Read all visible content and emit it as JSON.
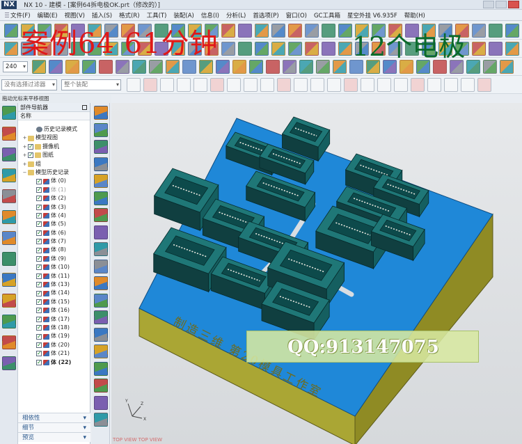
{
  "window": {
    "app_logo": "NX",
    "title": "NX 10 - 建模 - [案例64拆电极OK.prt（修改的）]"
  },
  "menu": {
    "items": [
      "文件(F)",
      "编辑(E)",
      "视图(V)",
      "插入(S)",
      "格式(R)",
      "工具(T)",
      "装配(A)",
      "信息(I)",
      "分析(L)",
      "首选项(P)",
      "窗口(O)",
      "GC工具箱",
      "星空外挂 V6.935F",
      "帮助(H)"
    ]
  },
  "toolbar": {
    "layer_value": "240",
    "filter_placeholder": "没有选择过滤器",
    "assembly_scope": "整个装配"
  },
  "overlays": {
    "red_caption": "案例64   61分钟",
    "green_caption": "12个电极",
    "qq_banner": "QQ:913147075"
  },
  "panel": {
    "drag_hint": "拖动光标来平移视图",
    "title": "部件导航器",
    "column_name": "名称",
    "nodes": [
      {
        "label": "历史记录模式",
        "level": 1,
        "check": false,
        "exp": ""
      },
      {
        "label": "模型视图",
        "level": 0,
        "check": false,
        "exp": "+"
      },
      {
        "label": "摄像机",
        "level": 0,
        "check": true,
        "exp": "+"
      },
      {
        "label": "图纸",
        "level": 0,
        "check": true,
        "exp": "+"
      },
      {
        "label": "组",
        "level": 0,
        "check": false,
        "exp": "+"
      },
      {
        "label": "模型历史记录",
        "level": 0,
        "check": false,
        "exp": "−"
      },
      {
        "label": "体 (0)",
        "level": 1,
        "check": true,
        "exp": ""
      },
      {
        "label": "体 (1)",
        "level": 1,
        "check": true,
        "exp": "",
        "dim": true
      },
      {
        "label": "体 (2)",
        "level": 1,
        "check": true,
        "exp": ""
      },
      {
        "label": "体 (3)",
        "level": 1,
        "check": true,
        "exp": ""
      },
      {
        "label": "体 (4)",
        "level": 1,
        "check": true,
        "exp": ""
      },
      {
        "label": "体 (5)",
        "level": 1,
        "check": true,
        "exp": ""
      },
      {
        "label": "体 (6)",
        "level": 1,
        "check": true,
        "exp": ""
      },
      {
        "label": "体 (7)",
        "level": 1,
        "check": true,
        "exp": ""
      },
      {
        "label": "体 (8)",
        "level": 1,
        "check": true,
        "exp": ""
      },
      {
        "label": "体 (9)",
        "level": 1,
        "check": true,
        "exp": ""
      },
      {
        "label": "体 (10)",
        "level": 1,
        "check": true,
        "exp": ""
      },
      {
        "label": "体 (11)",
        "level": 1,
        "check": true,
        "exp": ""
      },
      {
        "label": "体 (13)",
        "level": 1,
        "check": true,
        "exp": ""
      },
      {
        "label": "体 (14)",
        "level": 1,
        "check": true,
        "exp": ""
      },
      {
        "label": "体 (15)",
        "level": 1,
        "check": true,
        "exp": ""
      },
      {
        "label": "体 (16)",
        "level": 1,
        "check": true,
        "exp": ""
      },
      {
        "label": "体 (17)",
        "level": 1,
        "check": true,
        "exp": ""
      },
      {
        "label": "体 (18)",
        "level": 1,
        "check": true,
        "exp": ""
      },
      {
        "label": "体 (19)",
        "level": 1,
        "check": true,
        "exp": ""
      },
      {
        "label": "体 (20)",
        "level": 1,
        "check": true,
        "exp": ""
      },
      {
        "label": "体 (21)",
        "level": 1,
        "check": true,
        "exp": ""
      },
      {
        "label": "体 (22)",
        "level": 1,
        "check": true,
        "exp": "",
        "bold": true
      }
    ],
    "sections": [
      "相依性",
      "细节",
      "预览"
    ]
  },
  "viewport": {
    "engraved_text": "制造三维  第20模具工作室",
    "view_label": "TOP VIEW   TOP VIEW"
  },
  "colors": {
    "mold_top": "#1f88d8",
    "mold_side_front": "#a8a531",
    "mold_side_right": "#8f8b24",
    "electrode": "#1f7777",
    "electrode_dark": "#103f40",
    "overlay_red": "#e01818",
    "overlay_green": "#0b6a2b"
  }
}
